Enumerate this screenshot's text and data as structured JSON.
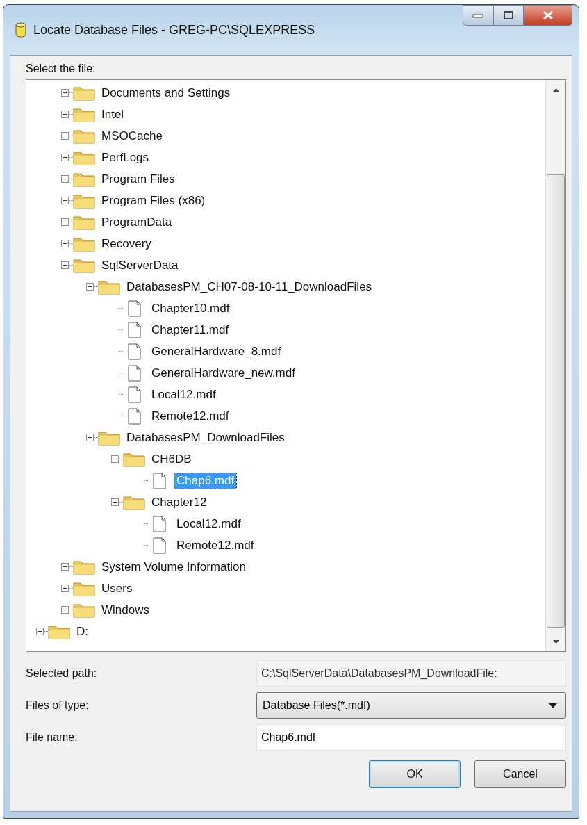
{
  "window": {
    "title": "Locate Database Files - GREG-PC\\SQLEXPRESS"
  },
  "tree": {
    "label": "Select the file:",
    "items": [
      {
        "label": "Documents and Settings",
        "kind": "folder",
        "expanded": false,
        "selected": false
      },
      {
        "label": "Intel",
        "kind": "folder",
        "expanded": false,
        "selected": false
      },
      {
        "label": "MSOCache",
        "kind": "folder",
        "expanded": false,
        "selected": false
      },
      {
        "label": "PerfLogs",
        "kind": "folder",
        "expanded": false,
        "selected": false
      },
      {
        "label": "Program Files",
        "kind": "folder",
        "expanded": false,
        "selected": false
      },
      {
        "label": "Program Files (x86)",
        "kind": "folder",
        "expanded": false,
        "selected": false
      },
      {
        "label": "ProgramData",
        "kind": "folder",
        "expanded": false,
        "selected": false
      },
      {
        "label": "Recovery",
        "kind": "folder",
        "expanded": false,
        "selected": false
      },
      {
        "label": "SqlServerData",
        "kind": "folder",
        "expanded": true,
        "selected": false,
        "children": [
          {
            "label": "DatabasesPM_CH07-08-10-11_DownloadFiles",
            "kind": "folder",
            "expanded": true,
            "selected": false,
            "children": [
              {
                "label": "Chapter10.mdf",
                "kind": "file",
                "selected": false
              },
              {
                "label": "Chapter11.mdf",
                "kind": "file",
                "selected": false
              },
              {
                "label": "GeneralHardware_8.mdf",
                "kind": "file",
                "selected": false
              },
              {
                "label": "GeneralHardware_new.mdf",
                "kind": "file",
                "selected": false
              },
              {
                "label": "Local12.mdf",
                "kind": "file",
                "selected": false
              },
              {
                "label": "Remote12.mdf",
                "kind": "file",
                "selected": false
              }
            ]
          },
          {
            "label": "DatabasesPM_DownloadFiles",
            "kind": "folder",
            "expanded": true,
            "selected": false,
            "children": [
              {
                "label": "CH6DB",
                "kind": "folder",
                "expanded": true,
                "selected": false,
                "children": [
                  {
                    "label": "Chap6.mdf",
                    "kind": "file",
                    "selected": true
                  }
                ]
              },
              {
                "label": "Chapter12",
                "kind": "folder",
                "expanded": true,
                "selected": false,
                "children": [
                  {
                    "label": "Local12.mdf",
                    "kind": "file",
                    "selected": false
                  },
                  {
                    "label": "Remote12.mdf",
                    "kind": "file",
                    "selected": false
                  }
                ]
              }
            ]
          }
        ]
      },
      {
        "label": "System Volume Information",
        "kind": "folder",
        "expanded": false,
        "selected": false
      },
      {
        "label": "Users",
        "kind": "folder",
        "expanded": false,
        "selected": false
      },
      {
        "label": "Windows",
        "kind": "folder",
        "expanded": false,
        "selected": false
      }
    ],
    "drives": [
      {
        "label": "D:",
        "kind": "folder",
        "expanded": false,
        "selected": false
      }
    ]
  },
  "selected_path": {
    "label": "Selected path:",
    "value": "C:\\SqlServerData\\DatabasesPM_DownloadFile:"
  },
  "files_of_type": {
    "label": "Files of type:",
    "value": "Database Files(*.mdf)"
  },
  "file_name": {
    "label": "File name:",
    "value": "Chap6.mdf"
  },
  "buttons": [
    {
      "label": "OK",
      "default": true
    },
    {
      "label": "Cancel",
      "default": false
    }
  ]
}
